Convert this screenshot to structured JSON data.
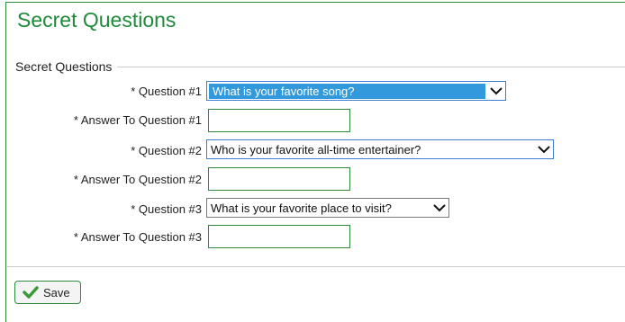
{
  "page": {
    "title": "Secret Questions"
  },
  "fieldset": {
    "legend": "Secret Questions"
  },
  "questions": [
    {
      "label": "* Question #1",
      "selected": "What is your favorite song?",
      "answer_label": "* Answer To Question #1",
      "answer_value": ""
    },
    {
      "label": "* Question #2",
      "selected": "Who is your favorite all-time entertainer?",
      "answer_label": "* Answer To Question #2",
      "answer_value": ""
    },
    {
      "label": "* Question #3",
      "selected": "What is your favorite place to visit?",
      "answer_label": "* Answer To Question #3",
      "answer_value": ""
    }
  ],
  "actions": {
    "save_label": "Save"
  },
  "colors": {
    "accent": "#1f8a3a",
    "border_green": "#2e8b3c",
    "select_highlight": "#3399dd"
  },
  "icons": {
    "save": "checkmark-icon",
    "dropdown": "chevron-down-icon"
  }
}
